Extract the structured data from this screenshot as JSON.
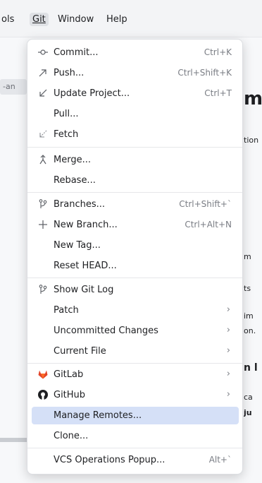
{
  "menubar": {
    "items": [
      {
        "label": "ols"
      },
      {
        "label": "Git"
      },
      {
        "label": "Window"
      },
      {
        "label": "Help"
      }
    ]
  },
  "background": {
    "tab_text": "-an",
    "heading": "m",
    "lines": [
      "tion",
      "m",
      "ts",
      "im",
      "on.",
      "n l",
      "ca",
      "ju"
    ]
  },
  "menu": {
    "items": [
      {
        "label": "Commit...",
        "shortcut": "Ctrl+K",
        "icon": "commit-icon"
      },
      {
        "label": "Push...",
        "shortcut": "Ctrl+Shift+K",
        "icon": "push-arrow-icon"
      },
      {
        "label": "Update Project...",
        "shortcut": "Ctrl+T",
        "icon": "update-arrow-icon"
      },
      {
        "label": "Pull...",
        "shortcut": "",
        "icon": ""
      },
      {
        "label": "Fetch",
        "shortcut": "",
        "icon": "fetch-arrow-icon"
      },
      {
        "label": "Merge...",
        "shortcut": "",
        "icon": "merge-icon"
      },
      {
        "label": "Rebase...",
        "shortcut": "",
        "icon": ""
      },
      {
        "label": "Branches...",
        "shortcut": "Ctrl+Shift+`",
        "icon": "branch-icon"
      },
      {
        "label": "New Branch...",
        "shortcut": "Ctrl+Alt+N",
        "icon": "plus-icon"
      },
      {
        "label": "New Tag...",
        "shortcut": "",
        "icon": ""
      },
      {
        "label": "Reset HEAD...",
        "shortcut": "",
        "icon": ""
      },
      {
        "label": "Show Git Log",
        "shortcut": "",
        "icon": "git-log-icon"
      },
      {
        "label": "Patch",
        "shortcut": "",
        "icon": ""
      },
      {
        "label": "Uncommitted Changes",
        "shortcut": "",
        "icon": ""
      },
      {
        "label": "Current File",
        "shortcut": "",
        "icon": ""
      },
      {
        "label": "GitLab",
        "shortcut": "",
        "icon": "gitlab-icon"
      },
      {
        "label": "GitHub",
        "shortcut": "",
        "icon": "github-icon"
      },
      {
        "label": "Manage Remotes...",
        "shortcut": "",
        "icon": ""
      },
      {
        "label": "Clone...",
        "shortcut": "",
        "icon": ""
      },
      {
        "label": "VCS Operations Popup...",
        "shortcut": "Alt+`",
        "icon": ""
      }
    ],
    "submenu_indicator": "›",
    "selected_item": "Manage Remotes...",
    "colors": {
      "selection": "#d5e0f7",
      "gitlab": "#e24329",
      "github": "#1e1f22"
    }
  }
}
